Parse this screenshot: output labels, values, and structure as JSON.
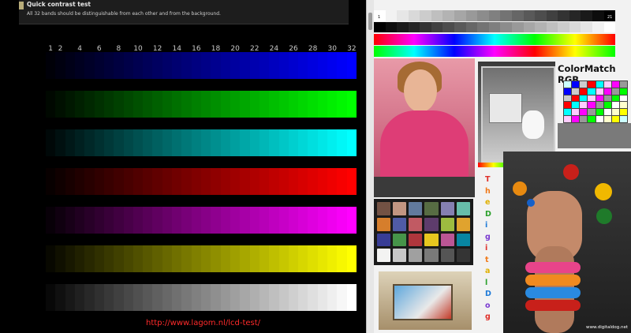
{
  "left_panel": {
    "header": {
      "title": "Quick contrast test",
      "description": "All 32 bands should be distinguishable from each other and from the background."
    },
    "step_labels": [
      "1",
      "2",
      "4",
      "6",
      "8",
      "10",
      "12",
      "14",
      "16",
      "18",
      "20",
      "22",
      "24",
      "26",
      "28",
      "30",
      "32"
    ],
    "bands": [
      {
        "name": "blue",
        "color": "#0000ff"
      },
      {
        "name": "green",
        "color": "#00ff00"
      },
      {
        "name": "cyan",
        "color": "#00ffff"
      },
      {
        "name": "red",
        "color": "#ff0000"
      },
      {
        "name": "magenta",
        "color": "#ff00ff"
      },
      {
        "name": "yellow",
        "color": "#ffff00"
      },
      {
        "name": "gray",
        "color": "#ffffff"
      }
    ],
    "url": "http://www.lagom.nl/lcd-test/"
  },
  "right_panel": {
    "gray_scale_labels": {
      "start": "1",
      "end": "21"
    },
    "colormatch_title": "ColorMatch RGB",
    "vertical_text": [
      "T",
      "h",
      "e",
      "D",
      "i",
      "g",
      "i",
      "t",
      "a",
      "l",
      "D",
      "o",
      "g"
    ],
    "watermark": "www.digitaldog.net",
    "vertical_text_colors": [
      "#e0302a",
      "#f07a1a",
      "#e0b000",
      "#2aa02a",
      "#1e7ad8",
      "#7a3ad0",
      "#e0302a",
      "#f07a1a",
      "#e0b000",
      "#2aa02a",
      "#1e7ad8",
      "#7a3ad0",
      "#e0302a"
    ],
    "checker_colors": [
      "#735244",
      "#c29682",
      "#627a9d",
      "#576c43",
      "#8580b1",
      "#67bdaa",
      "#d67e2c",
      "#505ba6",
      "#c15a63",
      "#5e3c6c",
      "#9dbc40",
      "#e0a32e",
      "#383d96",
      "#469449",
      "#af363c",
      "#e7c71f",
      "#bb5695",
      "#0885a1",
      "#f3f3f2",
      "#c8c8c8",
      "#a0a0a0",
      "#7a7a79",
      "#555555",
      "#343434"
    ]
  }
}
